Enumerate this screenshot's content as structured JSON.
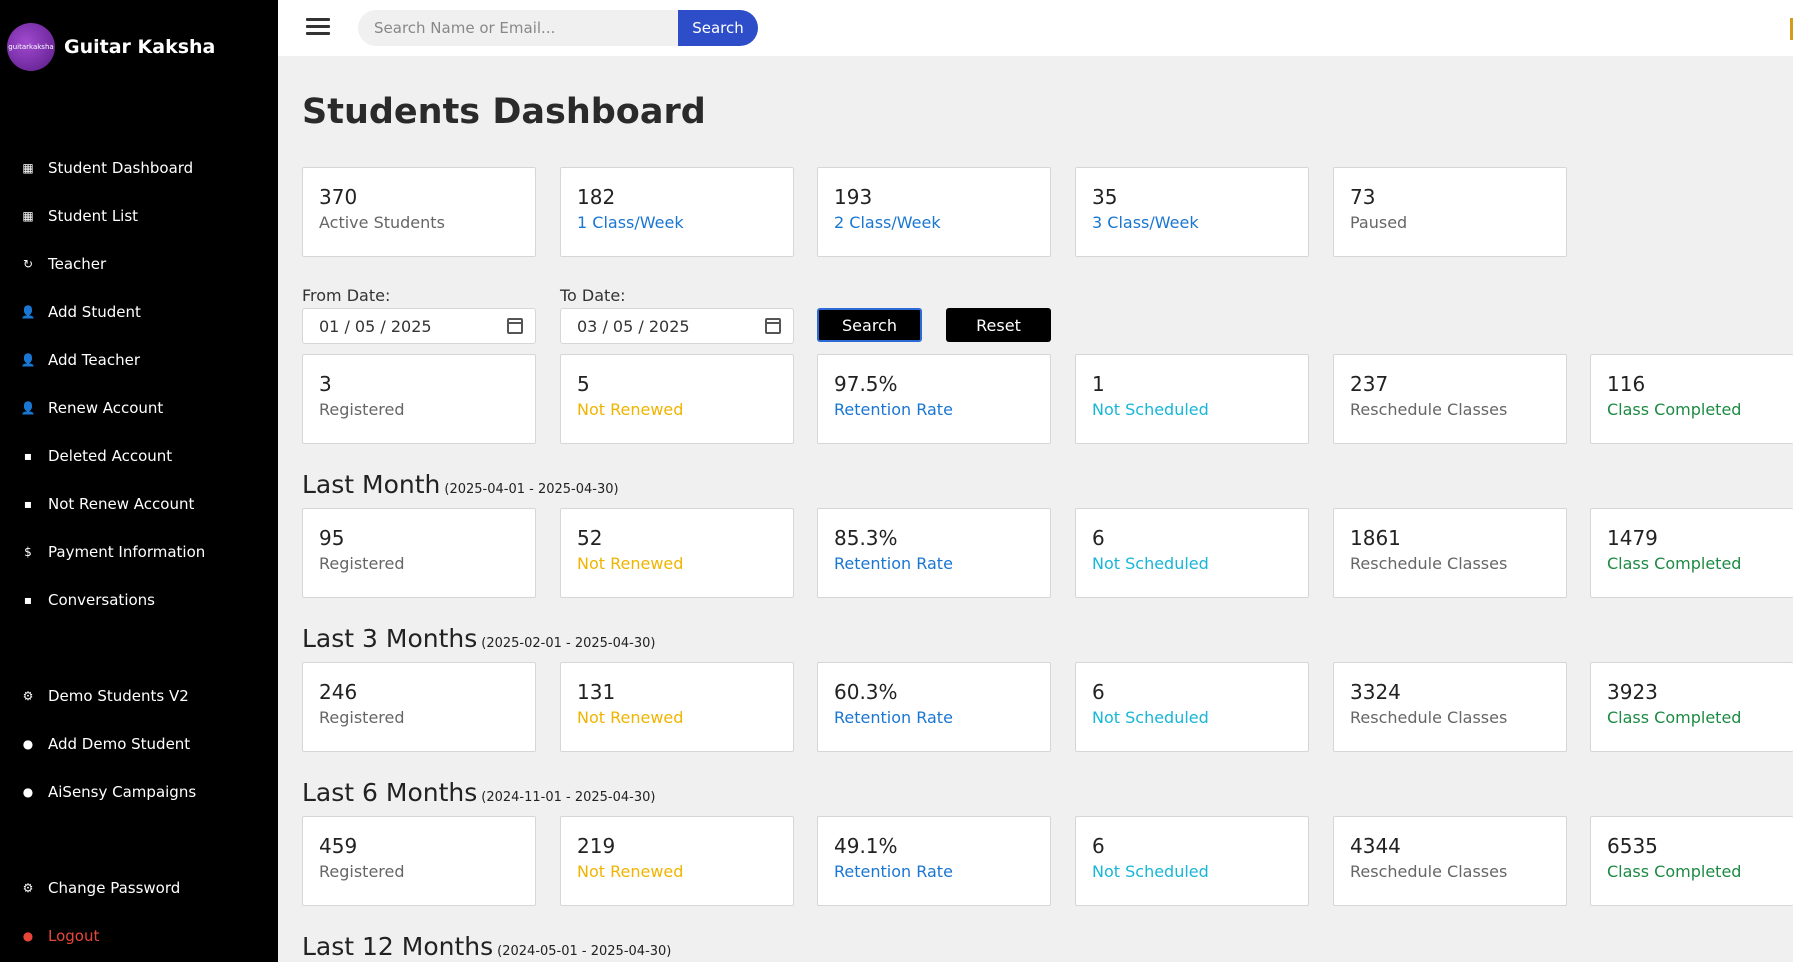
{
  "brand": {
    "name": "Guitar Kaksha",
    "logo_text": "guitarkaksha"
  },
  "sidebar": {
    "items": [
      {
        "label": "Student Dashboard",
        "icon": "grid-icon"
      },
      {
        "label": "Student List",
        "icon": "grid-icon"
      },
      {
        "label": "Teacher",
        "icon": "refresh-icon"
      },
      {
        "label": "Add Student",
        "icon": "user-add-icon"
      },
      {
        "label": "Add Teacher",
        "icon": "user-add-icon"
      },
      {
        "label": "Renew Account",
        "icon": "user-add-icon"
      },
      {
        "label": "Deleted Account",
        "icon": "message-icon"
      },
      {
        "label": "Not Renew Account",
        "icon": "message-icon"
      },
      {
        "label": "Payment Information",
        "icon": "dollar-icon"
      },
      {
        "label": "Conversations",
        "icon": "chat-icon"
      },
      {
        "label": "Demo Students V2",
        "icon": "gear-icon"
      },
      {
        "label": "Add Demo Student",
        "icon": "circle-icon"
      },
      {
        "label": "AiSensy Campaigns",
        "icon": "circle-icon"
      },
      {
        "label": "Change Password",
        "icon": "gear-icon"
      },
      {
        "label": "Logout",
        "icon": "logout-icon"
      }
    ]
  },
  "topbar": {
    "search_placeholder": "Search Name or Email...",
    "search_label": "Search"
  },
  "page": {
    "title": "Students Dashboard"
  },
  "summary": [
    {
      "value": "370",
      "label": "Active Students"
    },
    {
      "value": "182",
      "label": "1 Class/Week"
    },
    {
      "value": "193",
      "label": "2 Class/Week"
    },
    {
      "value": "35",
      "label": "3 Class/Week"
    },
    {
      "value": "73",
      "label": "Paused"
    }
  ],
  "filter": {
    "from_label": "From Date:",
    "from_value": "01 / 05 / 2025",
    "to_label": "To Date:",
    "to_value": "03 / 05 / 2025",
    "search_label": "Search",
    "reset_label": "Reset"
  },
  "stat_labels": [
    "Registered",
    "Not Renewed",
    "Retention Rate",
    "Not Scheduled",
    "Reschedule Classes",
    "Class Completed"
  ],
  "current": [
    "3",
    "5",
    "97.5%",
    "1",
    "237",
    "116"
  ],
  "sections": [
    {
      "title": "Last Month",
      "range": "(2025-04-01 - 2025-04-30)",
      "values": [
        "95",
        "52",
        "85.3%",
        "6",
        "1861",
        "1479"
      ]
    },
    {
      "title": "Last 3 Months",
      "range": "(2025-02-01 - 2025-04-30)",
      "values": [
        "246",
        "131",
        "60.3%",
        "6",
        "3324",
        "3923"
      ]
    },
    {
      "title": "Last 6 Months",
      "range": "(2024-11-01 - 2025-04-30)",
      "values": [
        "459",
        "219",
        "49.1%",
        "6",
        "4344",
        "6535"
      ]
    },
    {
      "title": "Last 12 Months",
      "range": "(2024-05-01 - 2025-04-30)"
    }
  ]
}
